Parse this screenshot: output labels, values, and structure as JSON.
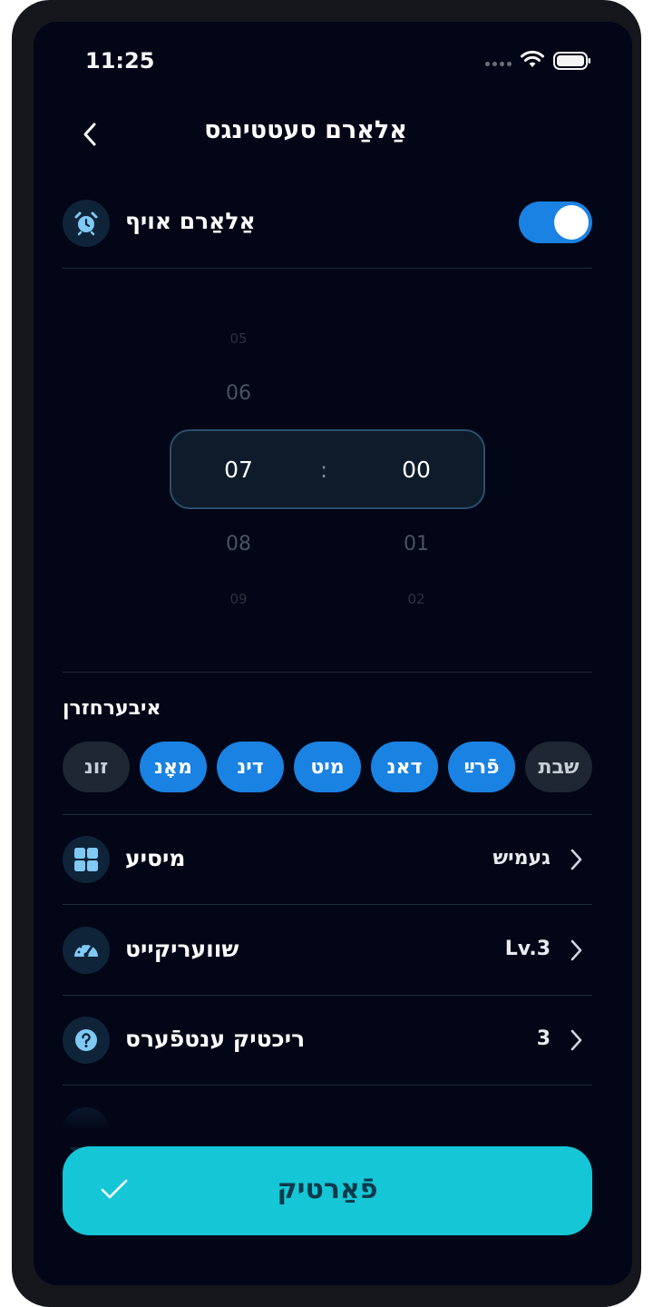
{
  "status_bar": {
    "time": "11:25"
  },
  "header": {
    "title": "אַלאַרם סעטטינגס",
    "back_icon": "chevron-left-icon"
  },
  "alarm_toggle": {
    "label": "אַלאַרם אויף",
    "icon": "alarm-clock-icon",
    "enabled": true
  },
  "time_picker": {
    "hours_above": [
      "05",
      "06"
    ],
    "hour_selected": "07",
    "hours_below": [
      "08",
      "09"
    ],
    "separator": ":",
    "minute_selected": "00",
    "minutes_below": [
      "01",
      "02"
    ]
  },
  "repeat": {
    "label": "איבערחזרן",
    "days": [
      {
        "label": "שבת",
        "active": false
      },
      {
        "label": "פֿרײַ",
        "active": true
      },
      {
        "label": "דאנ",
        "active": true
      },
      {
        "label": "מיט",
        "active": true
      },
      {
        "label": "דינ",
        "active": true
      },
      {
        "label": "מאָנ",
        "active": true
      },
      {
        "label": "זונ",
        "active": false
      }
    ]
  },
  "settings": [
    {
      "label": "מיסיע",
      "value": "געמיש",
      "icon": "grid-icon"
    },
    {
      "label": "שוועריקייט",
      "value": "Lv.3",
      "icon": "speedometer-icon"
    },
    {
      "label": "ריכטיק ענטפֿערס",
      "value": "3",
      "icon": "question-icon"
    }
  ],
  "save_button": {
    "label": "פֿאַרטיק",
    "icon": "check-icon"
  },
  "colors": {
    "accent": "#1a82e2",
    "button": "#15c6d6",
    "background": "#020617"
  }
}
